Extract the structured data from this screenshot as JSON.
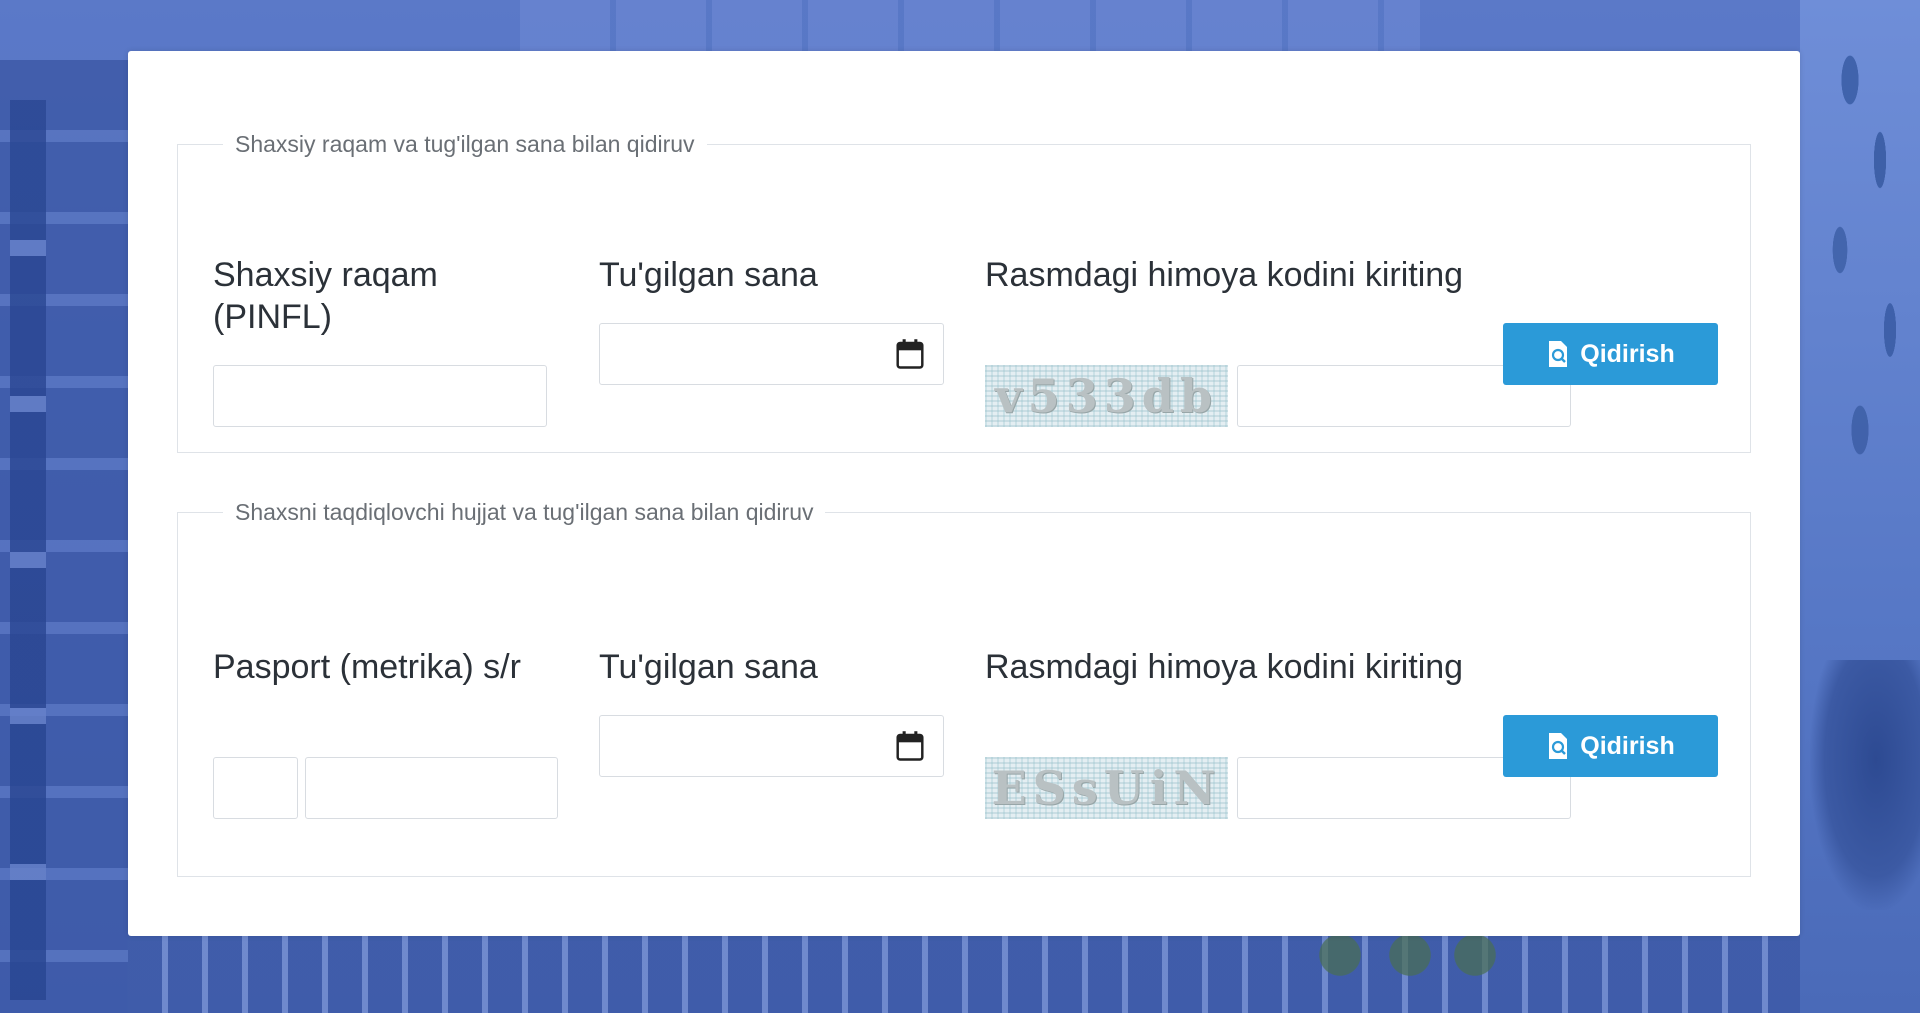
{
  "section1": {
    "legend": "Shaxsiy raqam va tug'ilgan sana bilan qidiruv",
    "pinfl_label": "Shaxsiy raqam (PINFL)",
    "pinfl_value": "",
    "birthdate_label": "Tu'gilgan sana",
    "birthdate_value": "",
    "captcha_label": "Rasmdagi himoya kodini kiriting",
    "captcha_text": "v533db",
    "captcha_value": "",
    "search_label": "Qidirish"
  },
  "section2": {
    "legend": "Shaxsni taqdiqlovchi hujjat va tug'ilgan sana bilan qidiruv",
    "passport_label": "Pasport (metrika) s/r",
    "passport_series_value": "",
    "passport_number_value": "",
    "birthdate_label": "Tu'gilgan sana",
    "birthdate_value": "",
    "captcha_label": "Rasmdagi himoya kodini kiriting",
    "captcha_text": "ESsUiN",
    "captcha_value": "",
    "search_label": "Qidirish"
  },
  "colors": {
    "button": "#2b9ad8",
    "legend_text": "#6a6f75",
    "label_text": "#2b3138",
    "background": "#4f6fc2"
  },
  "icons": {
    "calendar": "calendar-icon",
    "search_doc": "document-search-icon"
  }
}
